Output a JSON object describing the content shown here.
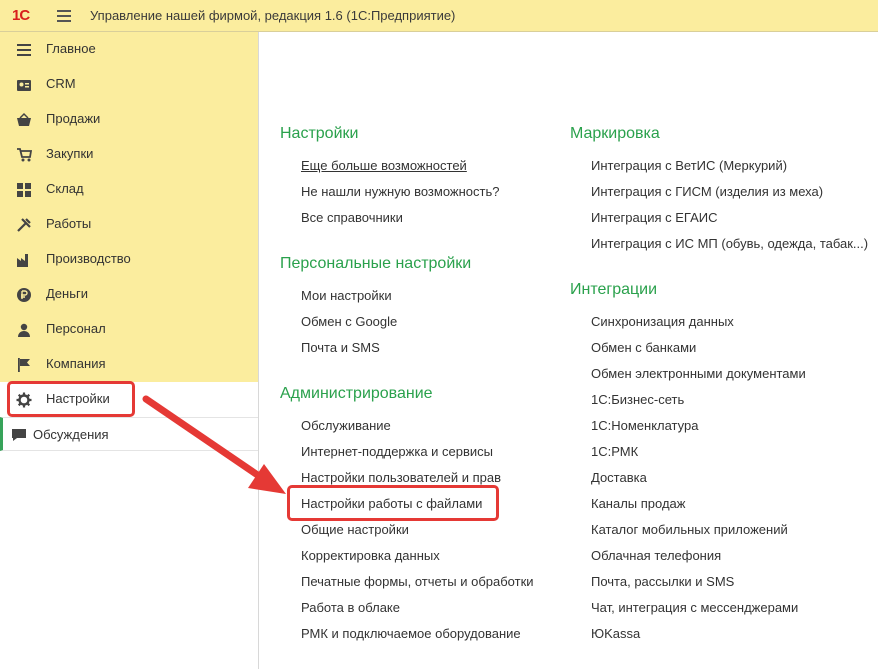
{
  "app": {
    "logo": "1С",
    "title": "Управление нашей фирмой, редакция 1.6  (1С:Предприятие)"
  },
  "sidebar": {
    "items": [
      {
        "label": "Главное",
        "icon": "menu-icon"
      },
      {
        "label": "CRM",
        "icon": "contacts-icon"
      },
      {
        "label": "Продажи",
        "icon": "basket-icon"
      },
      {
        "label": "Закупки",
        "icon": "cart-icon"
      },
      {
        "label": "Склад",
        "icon": "warehouse-icon"
      },
      {
        "label": "Работы",
        "icon": "tools-icon"
      },
      {
        "label": "Производство",
        "icon": "factory-icon"
      },
      {
        "label": "Деньги",
        "icon": "ruble-icon"
      },
      {
        "label": "Персонал",
        "icon": "person-icon"
      },
      {
        "label": "Компания",
        "icon": "flag-icon"
      },
      {
        "label": "Настройки",
        "icon": "gear-icon",
        "active": true
      }
    ],
    "discussions": "Обсуждения"
  },
  "content": {
    "col1": [
      {
        "title": "Настройки",
        "links": [
          "Еще больше возможностей",
          "Не нашли нужную возможность?",
          "Все справочники"
        ]
      },
      {
        "title": "Персональные настройки",
        "links": [
          "Мои настройки",
          "Обмен с Google",
          "Почта и SMS"
        ]
      },
      {
        "title": "Администрирование",
        "links": [
          "Обслуживание",
          "Интернет-поддержка и сервисы",
          "Настройки пользователей и прав",
          "Настройки работы с файлами",
          "Общие настройки",
          "Корректировка данных",
          "Печатные формы, отчеты и обработки",
          "Работа в облаке",
          "РМК и подключаемое оборудование"
        ]
      }
    ],
    "col2": [
      {
        "title": "Маркировка",
        "links": [
          "Интеграция с ВетИС (Меркурий)",
          "Интеграция с ГИСМ (изделия из меха)",
          "Интеграция с ЕГАИС",
          "Интеграция с ИС МП (обувь, одежда, табак...)"
        ]
      },
      {
        "title": "Интеграции",
        "links": [
          "Синхронизация данных",
          "Обмен с банками",
          "Обмен электронными документами",
          "1С:Бизнес-сеть",
          "1С:Номенклатура",
          "1С:РМК",
          "Доставка",
          "Каналы продаж",
          "Каталог мобильных приложений",
          "Облачная телефония",
          "Почта, рассылки и SMS",
          "Чат, интеграция с мессенджерами",
          "ЮKassa"
        ]
      }
    ]
  },
  "colors": {
    "accent_green": "#2aa14c",
    "sidebar_bg": "#fbed9e",
    "highlight_red": "#e53935"
  }
}
